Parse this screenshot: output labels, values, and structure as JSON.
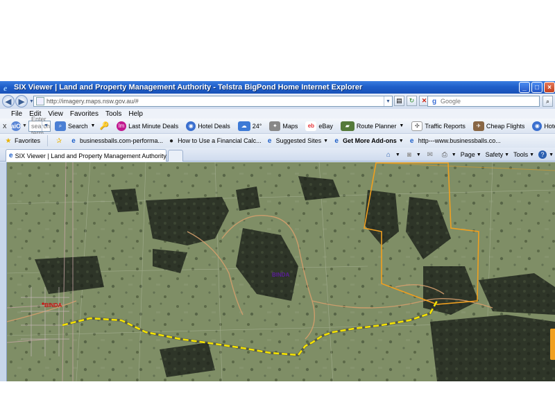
{
  "window": {
    "title": "SIX Viewer | Land and Property Management Authority - Telstra BigPond Home Internet Explorer"
  },
  "address_bar": {
    "url": "http://imagery.maps.nsw.gov.au/#",
    "search_placeholder": "Google"
  },
  "menu": {
    "items": [
      "File",
      "Edit",
      "View",
      "Favorites",
      "Tools",
      "Help"
    ]
  },
  "toolbar": {
    "close_label": "x",
    "search_placeholder": "Enter search term...",
    "search_label": "Search",
    "items": [
      {
        "label": "Last Minute Deals",
        "icon": "lastminute-icon",
        "color": "#c2188f"
      },
      {
        "label": "Hotel Deals",
        "icon": "hotel-icon",
        "color": "#3a6fcf"
      },
      {
        "label": "24°",
        "icon": "weather-icon",
        "color": "#3d7ad6"
      },
      {
        "label": "Maps",
        "icon": "maps-icon",
        "color": "#777777"
      },
      {
        "label": "eBay",
        "icon": "ebay-icon",
        "color": "#e53238"
      },
      {
        "label": "Route Planner",
        "icon": "route-icon",
        "color": "#557a3a"
      },
      {
        "label": "Traffic Reports",
        "icon": "traffic-icon",
        "color": "#666666"
      },
      {
        "label": "Cheap Flights",
        "icon": "flights-icon",
        "color": "#886644"
      },
      {
        "label": "Hote",
        "icon": "hotel-icon",
        "color": "#3a6fcf"
      }
    ]
  },
  "favorites_bar": {
    "favorites_label": "Favorites",
    "items": [
      {
        "label": "businessballs.com-performa...",
        "icon": "ie-page-icon"
      },
      {
        "label": "How to Use a Financial Calc...",
        "icon": "video-icon"
      },
      {
        "label": "Suggested Sites",
        "icon": "ie-page-icon",
        "dropdown": true
      },
      {
        "label": "Get More Add-ons",
        "icon": "ie-page-icon",
        "dropdown": true,
        "bold": true
      },
      {
        "label": "http---www.businessballs.co...",
        "icon": "ie-page-icon"
      }
    ]
  },
  "tabs": [
    {
      "label": "SIX Viewer | Land and Property Management Authority",
      "active": true
    }
  ],
  "command_bar": {
    "items": [
      {
        "label": "Page",
        "icon": "page-icon"
      },
      {
        "label": "Safety",
        "icon": "safety-icon"
      },
      {
        "label": "Tools",
        "icon": "tools-icon"
      }
    ]
  },
  "map": {
    "labels": [
      {
        "text": "BINDA",
        "color": "#5a1e96",
        "name": "place-label-binda-center"
      },
      {
        "text": "BINDA",
        "color": "#cc1111",
        "name": "place-label-binda-town"
      }
    ],
    "route_color": "#f5e300",
    "boundary_color": "#f0a020",
    "road_color": "#d59f6d"
  }
}
